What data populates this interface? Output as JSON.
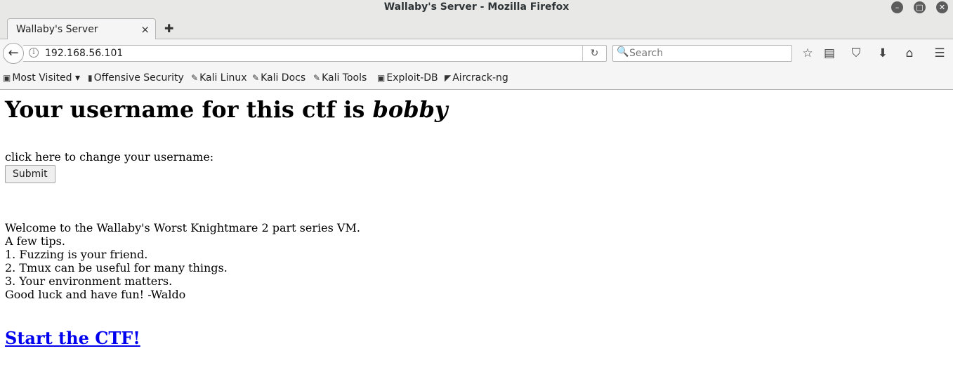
{
  "window": {
    "title": "Wallaby's Server - Mozilla Firefox"
  },
  "tabs": [
    {
      "label": "Wallaby's Server",
      "close": "×"
    }
  ],
  "new_tab": "✚",
  "navbar": {
    "back": "←",
    "info": "i",
    "url": "192.168.56.101",
    "reload": "↻",
    "search_placeholder": "Search",
    "search_icon": "🔍"
  },
  "toolbar_icons": {
    "bookmark_star": "☆",
    "library": "▤",
    "pocket": "⛉",
    "downloads": "⬇",
    "home": "⌂",
    "menu": "☰"
  },
  "bookmarks": [
    {
      "label": "Most Visited ▾",
      "icon": "▣"
    },
    {
      "label": "Offensive Security",
      "icon": "▮"
    },
    {
      "label": "Kali Linux",
      "icon": "✎"
    },
    {
      "label": "Kali Docs",
      "icon": "✎"
    },
    {
      "label": "Kali Tools",
      "icon": "✎"
    },
    {
      "label": "Exploit-DB",
      "icon": "▣"
    },
    {
      "label": "Aircrack-ng",
      "icon": "◤"
    }
  ],
  "page": {
    "heading_prefix": "Your username for this ctf is ",
    "username": "bobby",
    "change_link": "click here",
    "change_text": " to change your username:",
    "submit_label": "Submit",
    "tips": [
      "Welcome to the Wallaby's Worst Knightmare 2 part series VM.",
      "A few tips.",
      "1. Fuzzing is your friend.",
      "2. Tmux can be useful for many things.",
      "3. Your environment matters.",
      "Good luck and have fun! -Waldo"
    ],
    "start_link": "Start the CTF!"
  }
}
